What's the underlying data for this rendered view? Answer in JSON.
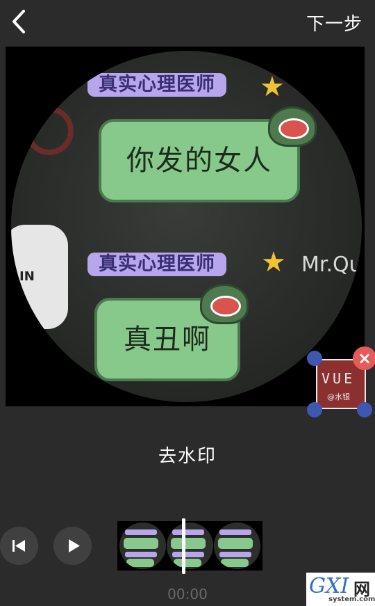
{
  "header": {
    "back_icon": "chevron-left-icon",
    "next_label": "下一步"
  },
  "preview": {
    "tag_1": "真实心理医师",
    "bubble_1": "你发的女人",
    "tag_2": "真实心理医师",
    "bubble_2": "真丑啊",
    "side_text": "Mr.Qu",
    "sticker_text": "IN"
  },
  "watermark": {
    "big_text": "VUE",
    "small_text": "@水银",
    "close_icon": "close-icon",
    "close_glyph": "×"
  },
  "actions": {
    "remove_watermark_label": "去水印"
  },
  "player": {
    "rewind_icon": "skip-back-icon",
    "play_icon": "play-icon",
    "time": "00:00"
  },
  "logo": {
    "brand": "GXI",
    "brand_cn": "网",
    "domain": "system.com"
  },
  "colors": {
    "background": "#2b2b2b",
    "bubble_green": "#86c98a",
    "tag_purple": "#b7a6ec",
    "close_red": "#e85a5a",
    "handle_blue": "#3e57b0"
  }
}
